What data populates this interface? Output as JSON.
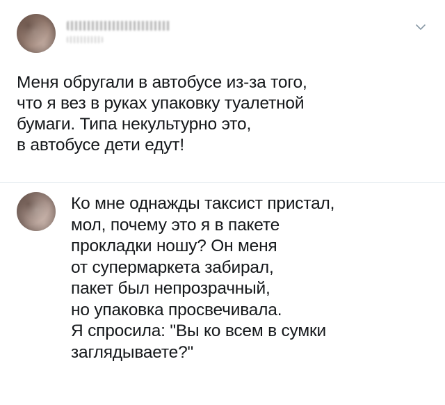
{
  "main_tweet": {
    "avatar_icon": "profile-photo",
    "text": "Меня обругали в автобусе из-за того,\nчто я вез в руках упаковку туалетной\nбумаги. Типа некультурно это,\nв автобусе дети едут!",
    "menu_icon": "chevron-down-icon"
  },
  "reply": {
    "avatar_icon": "profile-photo",
    "text": "Ко мне однажды таксист пристал,\nмол, почему это я в пакете\nпрокладки ношу? Он меня\nот супермаркета забирал,\nпакет был непрозрачный,\nно упаковка просвечивала.\nЯ спросила: \"Вы ко всем в сумки\nзаглядываете?\""
  },
  "colors": {
    "text": "#14171a",
    "divider": "#e6ecf0",
    "icon": "#8899a6",
    "background": "#ffffff"
  }
}
